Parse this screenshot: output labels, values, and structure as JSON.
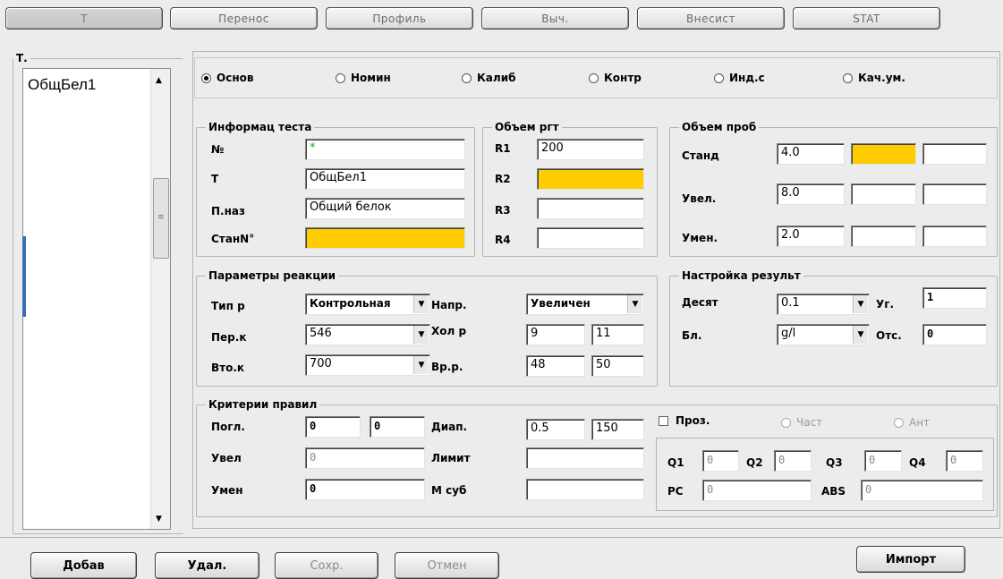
{
  "tabs": [
    "Т",
    "Перенос",
    "Профиль",
    "Выч.",
    "Внесист",
    "STAT"
  ],
  "test_list": {
    "title": "Т.",
    "items": [
      "ОбщБел1"
    ]
  },
  "radios": [
    {
      "label": "Основ",
      "checked": true,
      "enabled": true
    },
    {
      "label": "Номин",
      "checked": false,
      "enabled": true
    },
    {
      "label": "Калиб",
      "checked": false,
      "enabled": true
    },
    {
      "label": "Контр",
      "checked": false,
      "enabled": true
    },
    {
      "label": "Инд.с",
      "checked": false,
      "enabled": true
    },
    {
      "label": "Кач.ум.",
      "checked": false,
      "enabled": true
    }
  ],
  "info": {
    "title": "Информац теста",
    "no_label": "№",
    "no_value": "*",
    "t_label": "Т",
    "t_value": "ОбщБел1",
    "pnaz_label": "П.наз",
    "pnaz_value": "Общий белок",
    "stan_label": "СтанN°",
    "stan_value": ""
  },
  "reagent": {
    "title": "Объем ргт",
    "rows": [
      {
        "label": "R1",
        "value": "200"
      },
      {
        "label": "R2",
        "value": ""
      },
      {
        "label": "R3",
        "value": ""
      },
      {
        "label": "R4",
        "value": ""
      }
    ]
  },
  "sample": {
    "title": "Объем проб",
    "rows": [
      {
        "label": "Станд",
        "value": "4.0"
      },
      {
        "label": "Увел.",
        "value": "8.0"
      },
      {
        "label": "Умен.",
        "value": "2.0"
      }
    ]
  },
  "reaction": {
    "title": "Параметры реакции",
    "type_label": "Тип р",
    "type_value": "Контрольная",
    "dir_label": "Напр.",
    "dir_value": "Увеличен",
    "perk_label": "Пер.к",
    "perk_value": "546",
    "hol_label": "Хол р",
    "hol_value1": "9",
    "hol_value2": "11",
    "vtok_label": "Вто.к",
    "vtok_value": "700",
    "vrr_label": "Вр.р.",
    "vrr_value1": "48",
    "vrr_value2": "50"
  },
  "result": {
    "title": "Настройка результ",
    "dec_label": "Десят",
    "dec_value": "0.1",
    "ug_label": "Уг.",
    "ug_value": "1",
    "bl_label": "Бл.",
    "bl_value": "g/l",
    "ots_label": "Отс.",
    "ots_value": "0"
  },
  "criteria": {
    "title": "Критерии правил",
    "pogl_label": "Погл.",
    "pogl_value1": "0",
    "pogl_value2": "0",
    "diap_label": "Диап.",
    "diap_value1": "0.5",
    "diap_value2": "150",
    "proz_label": "Проз.",
    "chast_label": "Част",
    "ant_label": "Ант",
    "uvel_label": "Увел",
    "uvel_value": "0",
    "limit_label": "Лимит",
    "limit_value": "",
    "umen_label": "Умен",
    "umen_value": "0",
    "msub_label": "М суб",
    "msub_value": "",
    "q1_label": "Q1",
    "q1_value": "0",
    "q2_label": "Q2",
    "q2_value": "0",
    "q3_label": "Q3",
    "q3_value": "0",
    "q4_label": "Q4",
    "q4_value": "0",
    "pc_label": "PC",
    "pc_value": "0",
    "abs_label": "ABS",
    "abs_value": "0"
  },
  "buttons": {
    "add": "Добав",
    "delete": "Удал.",
    "save": "Сохр.",
    "cancel": "Отмен",
    "import": "Импорт"
  },
  "colors": {
    "required_field": "#ffcc00",
    "panel_bg": "#ececec"
  }
}
